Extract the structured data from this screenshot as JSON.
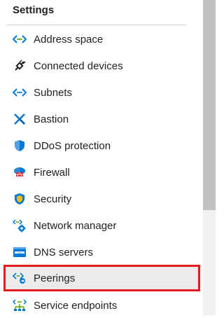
{
  "settings": {
    "title": "Settings",
    "items": [
      {
        "label": "Address space",
        "icon": "address-space-icon"
      },
      {
        "label": "Connected devices",
        "icon": "connected-devices-icon"
      },
      {
        "label": "Subnets",
        "icon": "subnets-icon"
      },
      {
        "label": "Bastion",
        "icon": "bastion-icon"
      },
      {
        "label": "DDoS protection",
        "icon": "ddos-shield-icon"
      },
      {
        "label": "Firewall",
        "icon": "firewall-icon"
      },
      {
        "label": "Security",
        "icon": "security-shield-icon"
      },
      {
        "label": "Network manager",
        "icon": "network-manager-icon"
      },
      {
        "label": "DNS servers",
        "icon": "dns-servers-icon"
      },
      {
        "label": "Peerings",
        "icon": "peerings-icon"
      },
      {
        "label": "Service endpoints",
        "icon": "service-endpoints-icon"
      }
    ]
  },
  "colors": {
    "accent_blue": "#0078d4",
    "selection_bg": "#edebe9",
    "highlight_red": "#e11c1c",
    "scroll_thumb": "#c1c1c1"
  }
}
